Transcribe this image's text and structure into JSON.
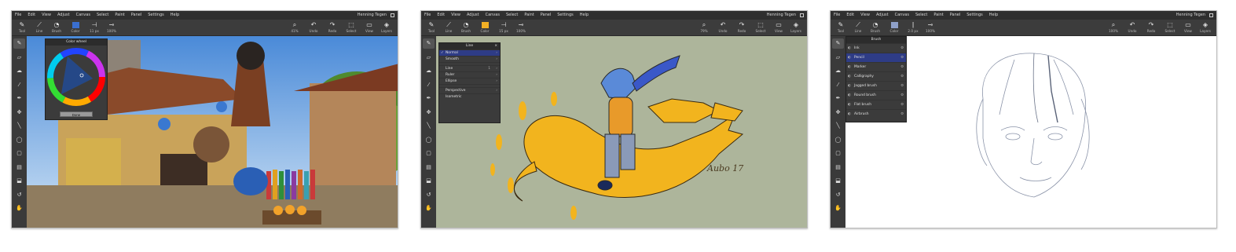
{
  "menus": [
    "File",
    "Edit",
    "View",
    "Adjust",
    "Canvas",
    "Select",
    "Paint",
    "Panel",
    "Settings",
    "Help"
  ],
  "user_name": "Henning Tegen",
  "shot1": {
    "toolbar_left": [
      {
        "icon": "brush-tool-icon",
        "glyph": "✎",
        "label": "Tool"
      },
      {
        "icon": "line-icon",
        "glyph": "⟋",
        "label": "Line"
      },
      {
        "icon": "brush-icon",
        "glyph": "◔",
        "label": "Brush"
      },
      {
        "icon": "color-swatch",
        "glyph": "",
        "label": "Color",
        "color": "#3a6fd0"
      },
      {
        "icon": "size-icon",
        "glyph": "⊣",
        "label": "11 px"
      },
      {
        "icon": "opacity-icon",
        "glyph": "⊸",
        "label": "100%"
      }
    ],
    "toolbar_right": [
      {
        "icon": "zoom-icon",
        "glyph": "⌕",
        "label": "41%"
      },
      {
        "icon": "undo-icon",
        "glyph": "↶",
        "label": "Undo"
      },
      {
        "icon": "redo-icon",
        "glyph": "↷",
        "label": "Redo"
      },
      {
        "icon": "select-icon",
        "glyph": "⬚",
        "label": "Select"
      },
      {
        "icon": "view-icon",
        "glyph": "▭",
        "label": "View"
      },
      {
        "icon": "layers-icon",
        "glyph": "◈",
        "label": "Layers"
      }
    ],
    "color_wheel": {
      "title": "Color wheel",
      "done_label": "Done",
      "close": "×"
    }
  },
  "shot2": {
    "toolbar_left": [
      {
        "icon": "brush-tool-icon",
        "glyph": "✎",
        "label": "Tool"
      },
      {
        "icon": "line-icon",
        "glyph": "⟋",
        "label": "Line"
      },
      {
        "icon": "brush-icon",
        "glyph": "◔",
        "label": "Brush"
      },
      {
        "icon": "color-swatch",
        "glyph": "",
        "label": "Color",
        "color": "#f2b025"
      },
      {
        "icon": "size-icon",
        "glyph": "⊣",
        "label": "15 px"
      },
      {
        "icon": "opacity-icon",
        "glyph": "⊸",
        "label": "100%"
      }
    ],
    "toolbar_right": [
      {
        "icon": "zoom-icon",
        "glyph": "⌕",
        "label": "79%"
      },
      {
        "icon": "undo-icon",
        "glyph": "↶",
        "label": "Undo"
      },
      {
        "icon": "redo-icon",
        "glyph": "↷",
        "label": "Redo"
      },
      {
        "icon": "select-icon",
        "glyph": "⬚",
        "label": "Select"
      },
      {
        "icon": "view-icon",
        "glyph": "▭",
        "label": "View"
      },
      {
        "icon": "layers-icon",
        "glyph": "◈",
        "label": "Layers"
      }
    ],
    "line_panel": {
      "title": "Line",
      "close": "×",
      "items": [
        {
          "label": "Normal",
          "checked": true,
          "highlight": true,
          "arrow": "›"
        },
        {
          "label": "Smooth",
          "checked": false,
          "highlight": false,
          "arrow": "›"
        },
        {
          "label": "",
          "spacer": true
        },
        {
          "label": "Line",
          "checked": false,
          "highlight": false,
          "arrow": "›",
          "extra": "1"
        },
        {
          "label": "Ruler",
          "checked": false,
          "highlight": false,
          "arrow": "›"
        },
        {
          "label": "Ellipse",
          "checked": false,
          "highlight": false,
          "arrow": "›"
        },
        {
          "label": "",
          "spacer": true
        },
        {
          "label": "Perspective",
          "checked": false,
          "highlight": false,
          "arrow": "›"
        },
        {
          "label": "Isometric",
          "checked": false,
          "highlight": false,
          "arrow": ""
        }
      ]
    },
    "signature": "Aubo 17"
  },
  "shot3": {
    "toolbar_left": [
      {
        "icon": "brush-tool-icon",
        "glyph": "✎",
        "label": "Tool"
      },
      {
        "icon": "line-icon",
        "glyph": "⟋",
        "label": "Line"
      },
      {
        "icon": "brush-icon",
        "glyph": "◔",
        "label": "Brush"
      },
      {
        "icon": "color-swatch",
        "glyph": "",
        "label": "Color",
        "color": "#8fa0c8"
      },
      {
        "icon": "size-icon",
        "glyph": "ǀ",
        "label": "2.0 px"
      },
      {
        "icon": "opacity-icon",
        "glyph": "⊸",
        "label": "100%"
      }
    ],
    "toolbar_right": [
      {
        "icon": "zoom-icon",
        "glyph": "⌕",
        "label": "100%"
      },
      {
        "icon": "undo-icon",
        "glyph": "↶",
        "label": "Undo"
      },
      {
        "icon": "redo-icon",
        "glyph": "↷",
        "label": "Redo"
      },
      {
        "icon": "select-icon",
        "glyph": "⬚",
        "label": "Select"
      },
      {
        "icon": "view-icon",
        "glyph": "▭",
        "label": "View"
      },
      {
        "icon": "layers-icon",
        "glyph": "◈",
        "label": "Layers"
      }
    ],
    "brush_panel": {
      "title": "Brush",
      "items": [
        {
          "label": "Ink",
          "highlight": false
        },
        {
          "label": "Pencil",
          "highlight": true
        },
        {
          "label": "Marker",
          "highlight": false
        },
        {
          "label": "Calligraphy",
          "highlight": false
        },
        {
          "label": "Jagged brush",
          "highlight": false
        },
        {
          "label": "Round brush",
          "highlight": false
        },
        {
          "label": "Flat brush",
          "highlight": false
        },
        {
          "label": "Airbrush",
          "highlight": false
        }
      ]
    }
  },
  "left_tools": [
    "brush-icon",
    "eraser-icon",
    "smudge-icon",
    "eyedropper-icon",
    "pen-icon",
    "move-icon",
    "line-icon",
    "lasso-icon",
    "rect-select-icon",
    "gradient-icon",
    "fill-icon",
    "rotate-icon",
    "hand-icon"
  ],
  "left_tool_glyphs": [
    "✎",
    "▱",
    "☁",
    "⁄",
    "✒",
    "✥",
    "╲",
    "◯",
    "▢",
    "▤",
    "⬓",
    "↺",
    "✋"
  ]
}
